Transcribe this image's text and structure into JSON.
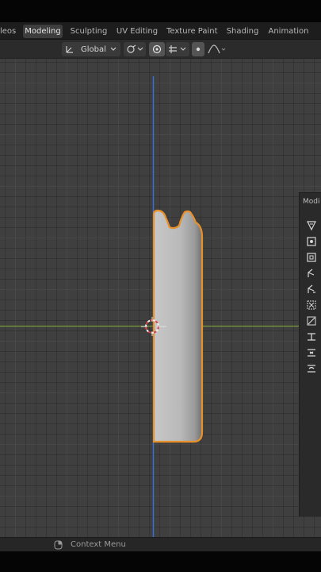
{
  "workspace_tabs": [
    {
      "label": "leos",
      "active": false
    },
    {
      "label": "Modeling",
      "active": true
    },
    {
      "label": "Sculpting",
      "active": false
    },
    {
      "label": "UV Editing",
      "active": false
    },
    {
      "label": "Texture Paint",
      "active": false
    },
    {
      "label": "Shading",
      "active": false
    },
    {
      "label": "Animation",
      "active": false
    }
  ],
  "header": {
    "orientation_value": "Global",
    "orientation_icon": "transform-orientation-icon",
    "pivot_icon": "pivot-link-icon",
    "snap_icon": "snap-magnet-icon",
    "snap_target_icon": "snap-target-icon",
    "proportional_icon": "proportional-edit-icon",
    "falloff_icon": "falloff-curve-icon"
  },
  "side_panel": {
    "tab_label": "Modi"
  },
  "status_bar": {
    "context_menu_label": "Context Menu",
    "mouse_icon": "mouse-right-icon"
  },
  "colors": {
    "viewport_bg": "#3f3f3f",
    "selection_outline": "#e8902a",
    "z_axis": "#3d6fd1",
    "y_axis": "#7a9a3a",
    "active_tab": "#3d3d3d"
  }
}
